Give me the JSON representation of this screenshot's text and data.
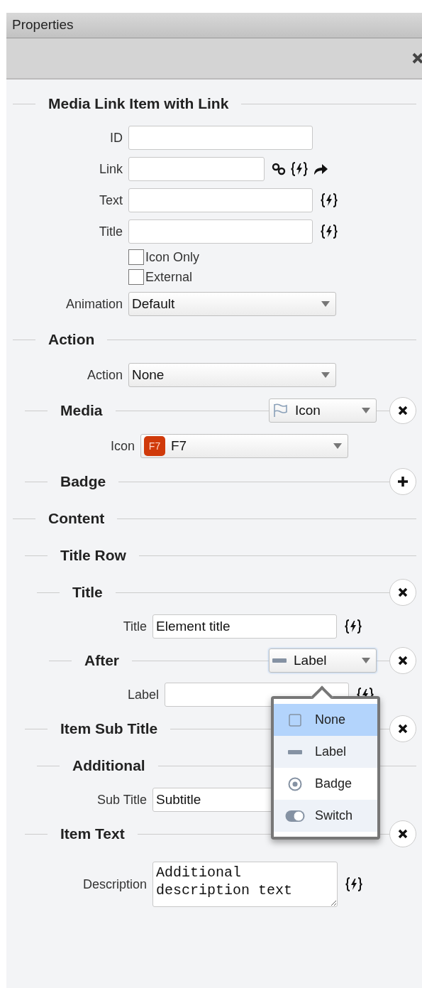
{
  "panel": {
    "title": "Properties"
  },
  "sections": [
    {
      "kind": "section",
      "title": "Media Link Item with Link",
      "items": [
        {
          "kind": "field",
          "label": "ID",
          "value": ""
        },
        {
          "kind": "field",
          "label": "Link",
          "value": "",
          "short": true,
          "link_tools": true
        },
        {
          "kind": "field",
          "label": "Text",
          "value": "",
          "dynamic": true
        },
        {
          "kind": "field",
          "label": "Title",
          "value": "",
          "dynamic": true
        },
        {
          "kind": "checkbox",
          "label": "Icon Only",
          "checked": false
        },
        {
          "kind": "checkbox",
          "label": "External",
          "checked": false
        },
        {
          "kind": "select",
          "label": "Animation",
          "value": "Default"
        }
      ]
    },
    {
      "kind": "section",
      "title": "Action",
      "items": [
        {
          "kind": "select",
          "label": "Action",
          "value": "None"
        },
        {
          "kind": "section",
          "title": "Media",
          "select": {
            "kind": "icon",
            "value": "Icon"
          },
          "button": {
            "kind": "remove"
          },
          "items": [
            {
              "kind": "select",
              "label": "Icon",
              "value": "F7",
              "badge": "F7"
            }
          ]
        },
        {
          "kind": "section",
          "title": "Badge",
          "button": {
            "kind": "add"
          }
        }
      ]
    },
    {
      "kind": "section",
      "title": "Content",
      "items": [
        {
          "kind": "section",
          "title": "Title Row",
          "items": [
            {
              "kind": "section",
              "title": "Title",
              "button": {
                "kind": "remove"
              },
              "items": [
                {
                  "kind": "field",
                  "label": "Title",
                  "value": "Element title",
                  "dynamic": true
                },
                {
                  "kind": "section",
                  "title": "After",
                  "button": {
                    "kind": "remove"
                  },
                  "select": {
                    "kind": "label",
                    "value": "Label",
                    "focused": true,
                    "options": [
                      {
                        "kind": "none",
                        "label": "None",
                        "highlighted": true
                      },
                      {
                        "kind": "label",
                        "label": "Label",
                        "highlighted": false
                      },
                      {
                        "kind": "badge",
                        "label": "Badge",
                        "highlighted": false
                      },
                      {
                        "kind": "switch",
                        "label": "Switch",
                        "highlighted": false
                      }
                    ]
                  },
                  "items": [
                    {
                      "kind": "field",
                      "label": "Label",
                      "value": "",
                      "dynamic": true
                    }
                  ]
                }
              ]
            }
          ]
        },
        {
          "kind": "section",
          "title": "Item Sub Title",
          "button": {
            "kind": "remove"
          },
          "items": [
            {
              "kind": "section",
              "title": "Additional",
              "items": [
                {
                  "kind": "field",
                  "label": "Sub Title",
                  "value": "Subtitle"
                }
              ]
            }
          ]
        },
        {
          "kind": "section",
          "title": "Item Text",
          "button": {
            "kind": "remove"
          },
          "items": [
            {
              "kind": "textarea",
              "label": "Description",
              "value": "Additional description text",
              "dynamic": true
            }
          ]
        }
      ]
    }
  ]
}
